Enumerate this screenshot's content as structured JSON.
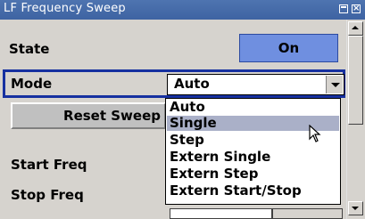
{
  "window": {
    "title": "LF Frequency Sweep"
  },
  "state": {
    "label": "State",
    "value": "On"
  },
  "mode": {
    "label": "Mode",
    "selected": "Auto",
    "options": [
      "Auto",
      "Single",
      "Step",
      "Extern Single",
      "Extern Step",
      "Extern Start/Stop"
    ],
    "highlighted": "Single"
  },
  "reset": {
    "label": "Reset Sweep"
  },
  "fields": {
    "start_freq_label": "Start Freq",
    "stop_freq_label": "Stop Freq"
  },
  "icons": {
    "close": "close-icon",
    "restore": "restore-icon",
    "dropdown": "chevron-down-icon",
    "cursor": "mouse-pointer-icon"
  },
  "colors": {
    "title_bar": "#4068a8",
    "on_button": "#6f8fe0",
    "focus_border": "#1630a0",
    "highlight": "#aab0c8"
  }
}
